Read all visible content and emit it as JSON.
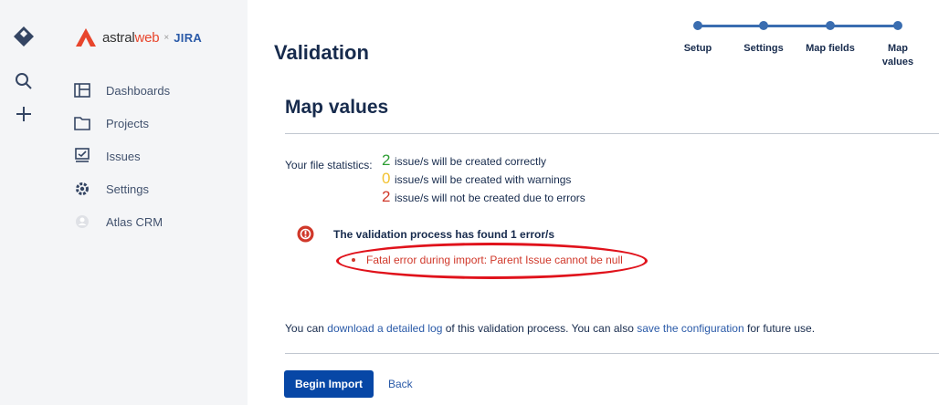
{
  "brand": {
    "name_plain": "astral",
    "name_accent": "web",
    "separator": "×",
    "partner": "JIRA"
  },
  "sidebar": {
    "items": [
      {
        "label": "Dashboards",
        "icon": "dashboard-icon"
      },
      {
        "label": "Projects",
        "icon": "folder-icon"
      },
      {
        "label": "Issues",
        "icon": "issues-icon"
      },
      {
        "label": "Settings",
        "icon": "gear-icon"
      },
      {
        "label": "Atlas CRM",
        "icon": "crm-icon"
      }
    ]
  },
  "page": {
    "title": "Validation"
  },
  "steps": [
    {
      "label": "Setup"
    },
    {
      "label": "Settings"
    },
    {
      "label": "Map fields"
    },
    {
      "label": "Map values"
    }
  ],
  "section": {
    "title": "Map values"
  },
  "stats": {
    "label": "Your file statistics:",
    "created": {
      "count": "2",
      "text": "issue/s will be created correctly"
    },
    "warnings": {
      "count": "0",
      "text": "issue/s will be created with warnings"
    },
    "errors": {
      "count": "2",
      "text": "issue/s will not be created due to errors"
    }
  },
  "validation": {
    "title": "The validation process has found 1 error/s",
    "errors": [
      "Fatal error during import: Parent Issue cannot be null"
    ]
  },
  "log": {
    "prefix": "You can",
    "link1": "download a detailed log",
    "middle": "of this validation process. You can also",
    "link2": "save the configuration",
    "suffix": "for future use."
  },
  "actions": {
    "primary": "Begin Import",
    "back": "Back"
  },
  "colors": {
    "primary": "#0747a6",
    "step": "#3a6db0",
    "ok": "#2e9e34",
    "warn": "#f2c230",
    "error": "#d0382a",
    "highlight": "#e0121b"
  }
}
